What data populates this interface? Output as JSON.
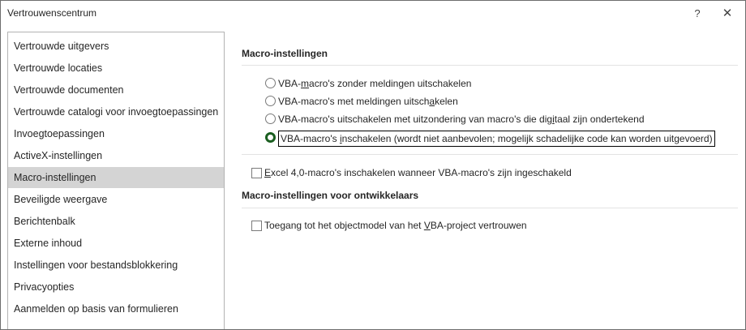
{
  "window": {
    "title": "Vertrouwenscentrum",
    "help_label": "?",
    "close_label": "✕"
  },
  "sidebar": {
    "items": [
      {
        "label": "Vertrouwde uitgevers",
        "selected": false
      },
      {
        "label": "Vertrouwde locaties",
        "selected": false
      },
      {
        "label": "Vertrouwde documenten",
        "selected": false
      },
      {
        "label": "Vertrouwde catalogi voor invoegtoepassingen",
        "selected": false
      },
      {
        "label": "Invoegtoepassingen",
        "selected": false
      },
      {
        "label": "ActiveX-instellingen",
        "selected": false
      },
      {
        "label": "Macro-instellingen",
        "selected": true
      },
      {
        "label": "Beveiligde weergave",
        "selected": false
      },
      {
        "label": "Berichtenbalk",
        "selected": false
      },
      {
        "label": "Externe inhoud",
        "selected": false
      },
      {
        "label": "Instellingen voor bestandsblokkering",
        "selected": false
      },
      {
        "label": "Privacyopties",
        "selected": false
      },
      {
        "label": "Aanmelden op basis van formulieren",
        "selected": false
      }
    ]
  },
  "macro_settings": {
    "title": "Macro-instellingen",
    "options": [
      {
        "pre": "VBA-",
        "ul": "m",
        "post": "acro's zonder meldingen uitschakelen",
        "checked": false
      },
      {
        "pre": "VBA-macro's met meldingen uitsch",
        "ul": "a",
        "post": "kelen",
        "checked": false
      },
      {
        "pre": "VBA-macro's uitschakelen met uitzondering van macro's die dig",
        "ul": "i",
        "post": "taal zijn ondertekend",
        "checked": false
      },
      {
        "pre": "VBA-macro's ",
        "ul": "i",
        "post": "nschakelen (wordt niet aanbevolen; mogelijk schadelijke code kan worden uitgevoerd)",
        "checked": true
      }
    ],
    "excel4": {
      "ul": "E",
      "post": "xcel 4,0-macro's inschakelen wanneer VBA-macro's zijn ingeschakeld",
      "checked": false
    }
  },
  "developer_settings": {
    "title": "Macro-instellingen voor ontwikkelaars",
    "trust": {
      "pre": "Toegang tot het objectmodel van het ",
      "ul": "V",
      "post": "BA-project vertrouwen",
      "checked": false
    }
  }
}
